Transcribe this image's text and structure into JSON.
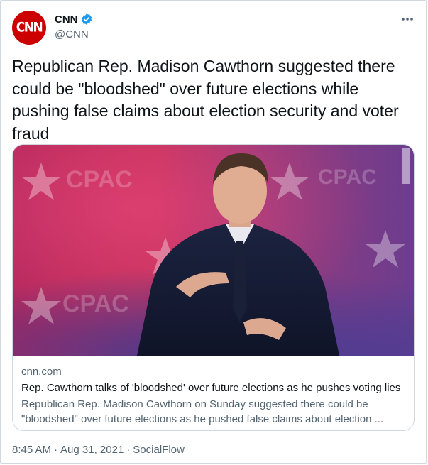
{
  "author": {
    "avatar_text": "CNN",
    "display_name": "CNN",
    "handle": "@CNN",
    "verified": true,
    "brand_color": "#cc0000",
    "verified_color": "#1d9bf0"
  },
  "tweet": {
    "text": "Republican Rep. Madison Cawthorn suggested there could be \"bloodshed\" over future elections while pushing false claims about election security and voter fraud"
  },
  "link_card": {
    "image_icon": "photo-of-man-in-suit-at-cpac",
    "domain": "cnn.com",
    "title": "Rep. Cawthorn talks of 'bloodshed' over future elections as he pushes voting lies",
    "description_line1": "Republican Rep. Madison Cawthorn on Sunday suggested there could be",
    "description_line2": "\"bloodshed\" over future elections as he pushed false claims about election ..."
  },
  "meta": {
    "time": "8:45 AM",
    "date": "Aug 31, 2021",
    "source": "SocialFlow",
    "separator": "·"
  },
  "icons": {
    "more": "more-horizontal-icon",
    "verified": "verified-badge-icon"
  }
}
